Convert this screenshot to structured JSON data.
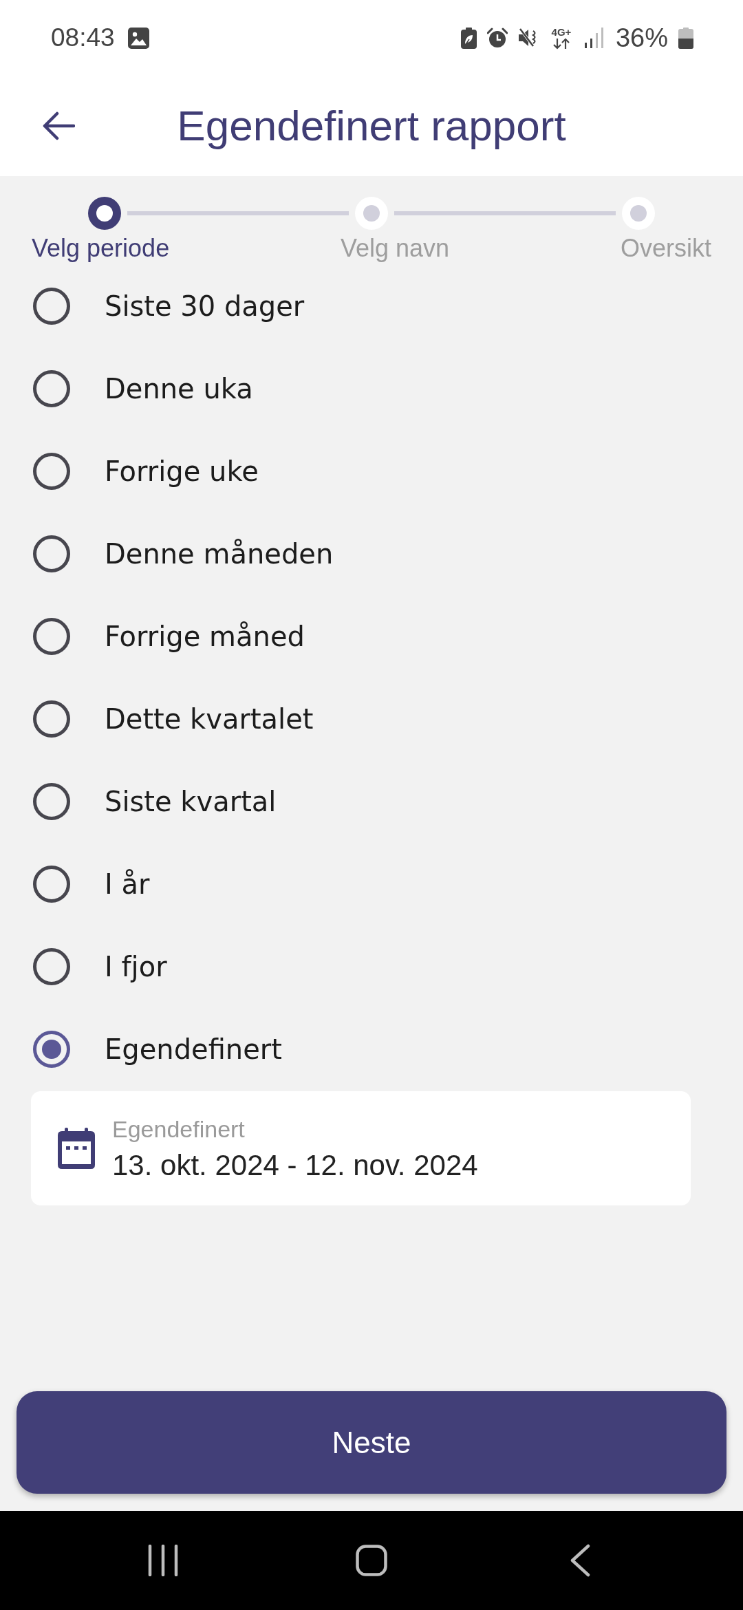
{
  "status_bar": {
    "time": "08:43",
    "network": "4G+",
    "battery": "36%"
  },
  "header": {
    "title": "Egendefinert rapport"
  },
  "stepper": {
    "steps": [
      {
        "label": "Velg periode",
        "selected": true
      },
      {
        "label": "Velg navn",
        "selected": false
      },
      {
        "label": "Oversikt",
        "selected": false
      }
    ]
  },
  "periods": [
    {
      "label": "Siste 30 dager",
      "selected": false
    },
    {
      "label": "Denne uka",
      "selected": false
    },
    {
      "label": "Forrige uke",
      "selected": false
    },
    {
      "label": "Denne måneden",
      "selected": false
    },
    {
      "label": "Forrige måned",
      "selected": false
    },
    {
      "label": "Dette kvartalet",
      "selected": false
    },
    {
      "label": "Siste kvartal",
      "selected": false
    },
    {
      "label": "I år",
      "selected": false
    },
    {
      "label": "I fjor",
      "selected": false
    },
    {
      "label": "Egendefinert",
      "selected": true
    }
  ],
  "custom_range": {
    "label": "Egendefinert",
    "value": "13. okt. 2024 - 12. nov. 2024"
  },
  "next_button": {
    "label": "Neste"
  }
}
